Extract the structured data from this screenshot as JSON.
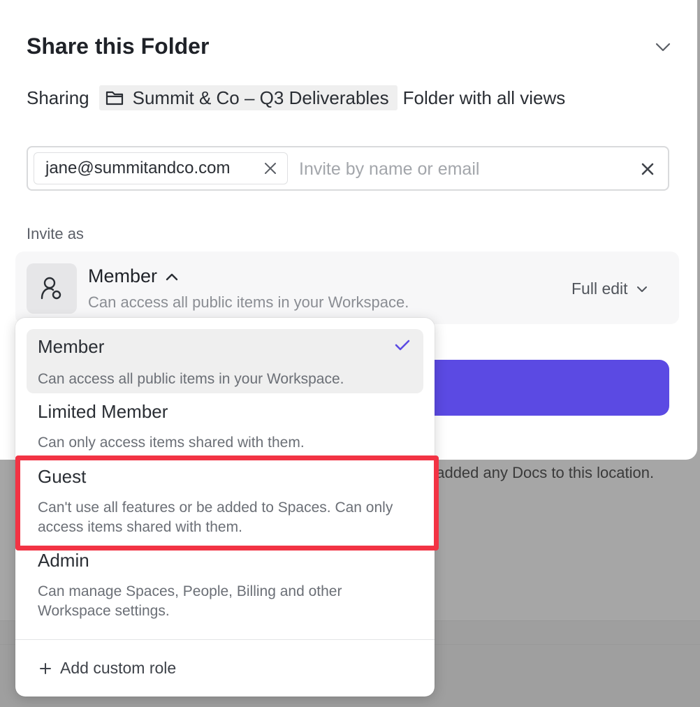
{
  "modal": {
    "title": "Share this Folder",
    "sharing_prefix": "Sharing",
    "folder_name": "Summit & Co – Q3 Deliverables",
    "sharing_suffix": "Folder with all views"
  },
  "invite": {
    "chip_email": "jane@summitandco.com",
    "placeholder": "Invite by name or email"
  },
  "invite_as": {
    "label": "Invite as",
    "role": "Member",
    "role_desc": "Can access all public items in your Workspace.",
    "permission": "Full edit"
  },
  "dropdown": {
    "options": [
      {
        "title": "Member",
        "desc": "Can access all public items in your Workspace.",
        "selected": true
      },
      {
        "title": "Limited Member",
        "desc": "Can only access items shared with them.",
        "selected": false
      },
      {
        "title": "Guest",
        "desc": "Can't use all features or be added to Spaces. Can only access items shared with them.",
        "selected": false
      },
      {
        "title": "Admin",
        "desc": "Can manage Spaces, People, Billing and other Workspace settings.",
        "selected": false
      }
    ],
    "add_custom": "Add custom role"
  },
  "background": {
    "text": "t added any Docs to this location."
  },
  "colors": {
    "accent": "#5b4ae3",
    "highlight": "#f23344"
  }
}
